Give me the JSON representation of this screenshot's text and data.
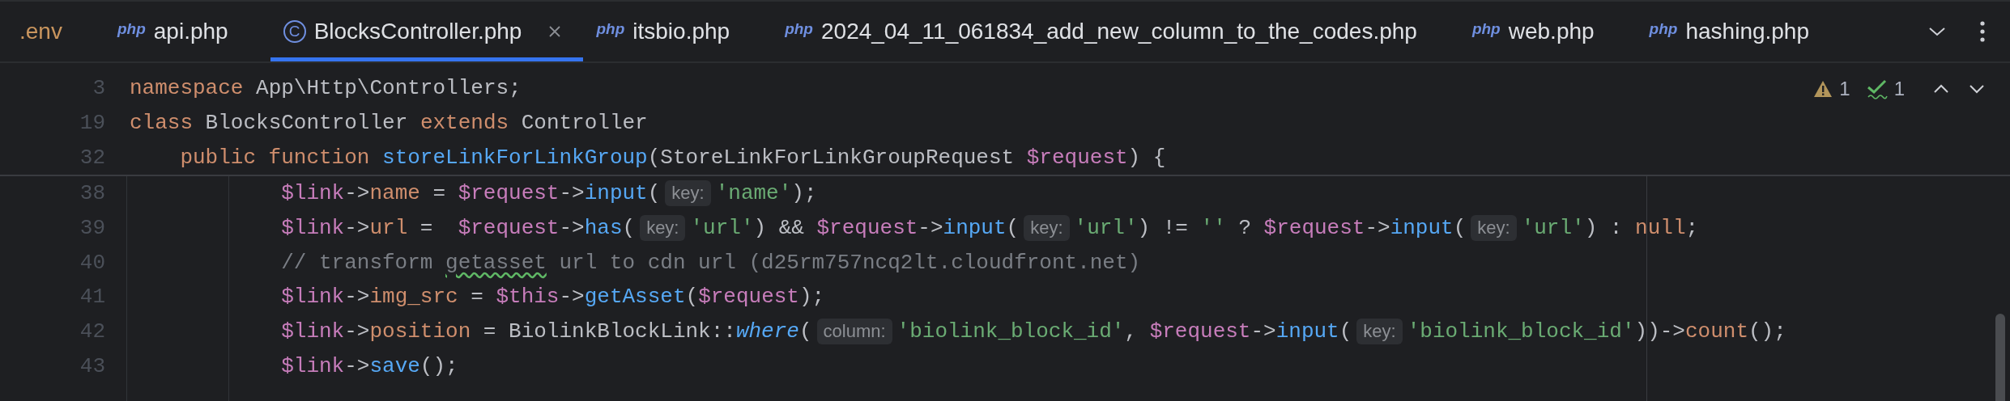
{
  "tabs": [
    {
      "label": ".env",
      "kind": "env",
      "selected": false
    },
    {
      "label": "api.php",
      "kind": "php",
      "icon": "php",
      "selected": false
    },
    {
      "label": "BlocksController.php",
      "kind": "class",
      "icon": "C",
      "selected": true
    },
    {
      "label": "itsbio.php",
      "kind": "php",
      "icon": "php",
      "selected": false
    },
    {
      "label": "2024_04_11_061834_add_new_column_to_the_codes.php",
      "kind": "php",
      "icon": "php",
      "selected": false
    },
    {
      "label": "web.php",
      "kind": "php",
      "icon": "php",
      "selected": false
    },
    {
      "label": "hashing.php",
      "kind": "php",
      "icon": "php",
      "selected": false
    }
  ],
  "inspections": [
    {
      "kind": "warning",
      "count": "1"
    },
    {
      "kind": "typo",
      "count": "1"
    }
  ],
  "lines": [
    {
      "number": "3",
      "sticky": true,
      "tokens": [
        {
          "text": "namespace",
          "kind": "kw"
        },
        {
          "text": " App\\Http\\Controllers;",
          "kind": "plain"
        }
      ]
    },
    {
      "number": "19",
      "sticky": true,
      "tokens": [
        {
          "text": "class",
          "kind": "kw"
        },
        {
          "text": " BlocksController ",
          "kind": "plain"
        },
        {
          "text": "extends",
          "kind": "kw"
        },
        {
          "text": " Controller",
          "kind": "plain"
        }
      ],
      "children": [
        {
          "number": "32",
          "sticky": true,
          "tokens": [
            {
              "text": "public function ",
              "kind": "kw"
            },
            {
              "text": "storeLinkForLinkGroup",
              "kind": "fn"
            },
            {
              "text": "(StoreLinkForLinkGroupRequest ",
              "kind": "plain"
            },
            {
              "text": "$request",
              "kind": "var"
            },
            {
              "text": ") {",
              "kind": "plain"
            }
          ],
          "children": [
            {
              "number": "38",
              "sticky": false,
              "tokens": [
                {
                  "text": "$link",
                  "kind": "var"
                },
                {
                  "text": "->",
                  "kind": "plain"
                },
                {
                  "text": "name",
                  "kind": "prop"
                },
                {
                  "text": " = ",
                  "kind": "plain"
                },
                {
                  "text": "$request",
                  "kind": "var"
                },
                {
                  "text": "->",
                  "kind": "plain"
                },
                {
                  "text": "input",
                  "kind": "fn"
                },
                {
                  "text": "(",
                  "kind": "plain"
                },
                {
                  "text": "key:",
                  "kind": "hint"
                },
                {
                  "text": "'name'",
                  "kind": "str"
                },
                {
                  "text": ");",
                  "kind": "plain"
                }
              ]
            },
            {
              "number": "39",
              "sticky": false,
              "tokens": [
                {
                  "text": "$link",
                  "kind": "var"
                },
                {
                  "text": "->",
                  "kind": "plain"
                },
                {
                  "text": "url",
                  "kind": "prop"
                },
                {
                  "text": " =  ",
                  "kind": "plain"
                },
                {
                  "text": "$request",
                  "kind": "var"
                },
                {
                  "text": "->",
                  "kind": "plain"
                },
                {
                  "text": "has",
                  "kind": "fn"
                },
                {
                  "text": "(",
                  "kind": "plain"
                },
                {
                  "text": "key:",
                  "kind": "hint"
                },
                {
                  "text": "'url'",
                  "kind": "str"
                },
                {
                  "text": ") && ",
                  "kind": "plain"
                },
                {
                  "text": "$request",
                  "kind": "var"
                },
                {
                  "text": "->",
                  "kind": "plain"
                },
                {
                  "text": "input",
                  "kind": "fn"
                },
                {
                  "text": "(",
                  "kind": "plain"
                },
                {
                  "text": "key:",
                  "kind": "hint"
                },
                {
                  "text": "'url'",
                  "kind": "str"
                },
                {
                  "text": ") != ",
                  "kind": "plain"
                },
                {
                  "text": "''",
                  "kind": "str"
                },
                {
                  "text": " ? ",
                  "kind": "plain"
                },
                {
                  "text": "$request",
                  "kind": "var"
                },
                {
                  "text": "->",
                  "kind": "plain"
                },
                {
                  "text": "input",
                  "kind": "fn"
                },
                {
                  "text": "(",
                  "kind": "plain"
                },
                {
                  "text": "key:",
                  "kind": "hint"
                },
                {
                  "text": "'url'",
                  "kind": "str"
                },
                {
                  "text": ") : ",
                  "kind": "plain"
                },
                {
                  "text": "null",
                  "kind": "kw"
                },
                {
                  "text": ";",
                  "kind": "plain"
                }
              ]
            },
            {
              "number": "40",
              "sticky": false,
              "tokens": [
                {
                  "text": "// transform ",
                  "kind": "comment"
                },
                {
                  "text": "getasset",
                  "kind": "typo"
                },
                {
                  "text": " url to cdn url (d25rm757ncq2lt.cloudfront.net)",
                  "kind": "comment"
                }
              ]
            },
            {
              "number": "41",
              "sticky": false,
              "tokens": [
                {
                  "text": "$link",
                  "kind": "var"
                },
                {
                  "text": "->",
                  "kind": "plain"
                },
                {
                  "text": "img_src",
                  "kind": "prop"
                },
                {
                  "text": " = ",
                  "kind": "plain"
                },
                {
                  "text": "$this",
                  "kind": "var"
                },
                {
                  "text": "->",
                  "kind": "plain"
                },
                {
                  "text": "getAsset",
                  "kind": "fn"
                },
                {
                  "text": "(",
                  "kind": "plain"
                },
                {
                  "text": "$request",
                  "kind": "var"
                },
                {
                  "text": ");",
                  "kind": "plain"
                }
              ]
            },
            {
              "number": "42",
              "sticky": false,
              "tokens": [
                {
                  "text": "$link",
                  "kind": "var"
                },
                {
                  "text": "->",
                  "kind": "plain"
                },
                {
                  "text": "position",
                  "kind": "prop"
                },
                {
                  "text": " = BiolinkBlockLink::",
                  "kind": "plain"
                },
                {
                  "text": "where",
                  "kind": "static"
                },
                {
                  "text": "(",
                  "kind": "plain"
                },
                {
                  "text": "column:",
                  "kind": "hint"
                },
                {
                  "text": "'biolink_block_id'",
                  "kind": "str"
                },
                {
                  "text": ", ",
                  "kind": "plain"
                },
                {
                  "text": "$request",
                  "kind": "var"
                },
                {
                  "text": "->",
                  "kind": "plain"
                },
                {
                  "text": "input",
                  "kind": "fn"
                },
                {
                  "text": "(",
                  "kind": "plain"
                },
                {
                  "text": "key:",
                  "kind": "hint"
                },
                {
                  "text": "'biolink_block_id'",
                  "kind": "str"
                },
                {
                  "text": "))->",
                  "kind": "plain"
                },
                {
                  "text": "count",
                  "kind": "prop"
                },
                {
                  "text": "();",
                  "kind": "plain"
                }
              ]
            },
            {
              "number": "43",
              "sticky": false,
              "tokens": [
                {
                  "text": "$link",
                  "kind": "var"
                },
                {
                  "text": "->",
                  "kind": "plain"
                },
                {
                  "text": "save",
                  "kind": "fn"
                },
                {
                  "text": "();",
                  "kind": "plain"
                }
              ]
            }
          ]
        }
      ]
    }
  ]
}
